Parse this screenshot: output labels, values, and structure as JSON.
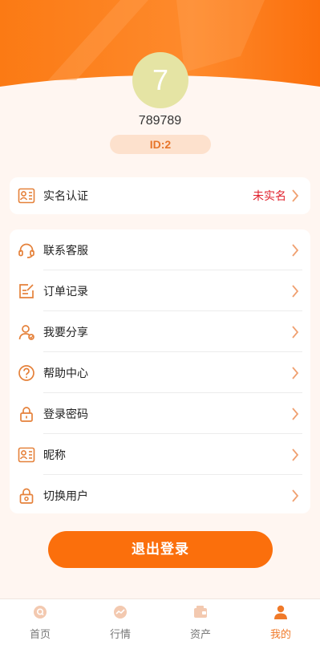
{
  "profile": {
    "avatar_text": "7",
    "username": "789789",
    "id_badge": "ID:2"
  },
  "verify": {
    "label": "实名认证",
    "status": "未实名",
    "icon": "id-card-icon"
  },
  "menu": [
    {
      "label": "联系客服",
      "icon": "headset-icon"
    },
    {
      "label": "订单记录",
      "icon": "order-edit-icon"
    },
    {
      "label": "我要分享",
      "icon": "user-share-icon"
    },
    {
      "label": "帮助中心",
      "icon": "help-circle-icon"
    },
    {
      "label": "登录密码",
      "icon": "lock-icon"
    },
    {
      "label": "昵称",
      "icon": "id-card-icon"
    },
    {
      "label": "切换用户",
      "icon": "switch-user-lock-icon"
    }
  ],
  "logout_label": "退出登录",
  "tabs": [
    {
      "label": "首页",
      "icon": "home-icon",
      "active": false
    },
    {
      "label": "行情",
      "icon": "market-icon",
      "active": false
    },
    {
      "label": "资产",
      "icon": "wallet-icon",
      "active": false
    },
    {
      "label": "我的",
      "icon": "person-icon",
      "active": true
    }
  ],
  "colors": {
    "accent": "#fb6f0c",
    "icon_orange": "#e5813a",
    "status_red": "#e0212d",
    "background": "#fff6f1"
  }
}
